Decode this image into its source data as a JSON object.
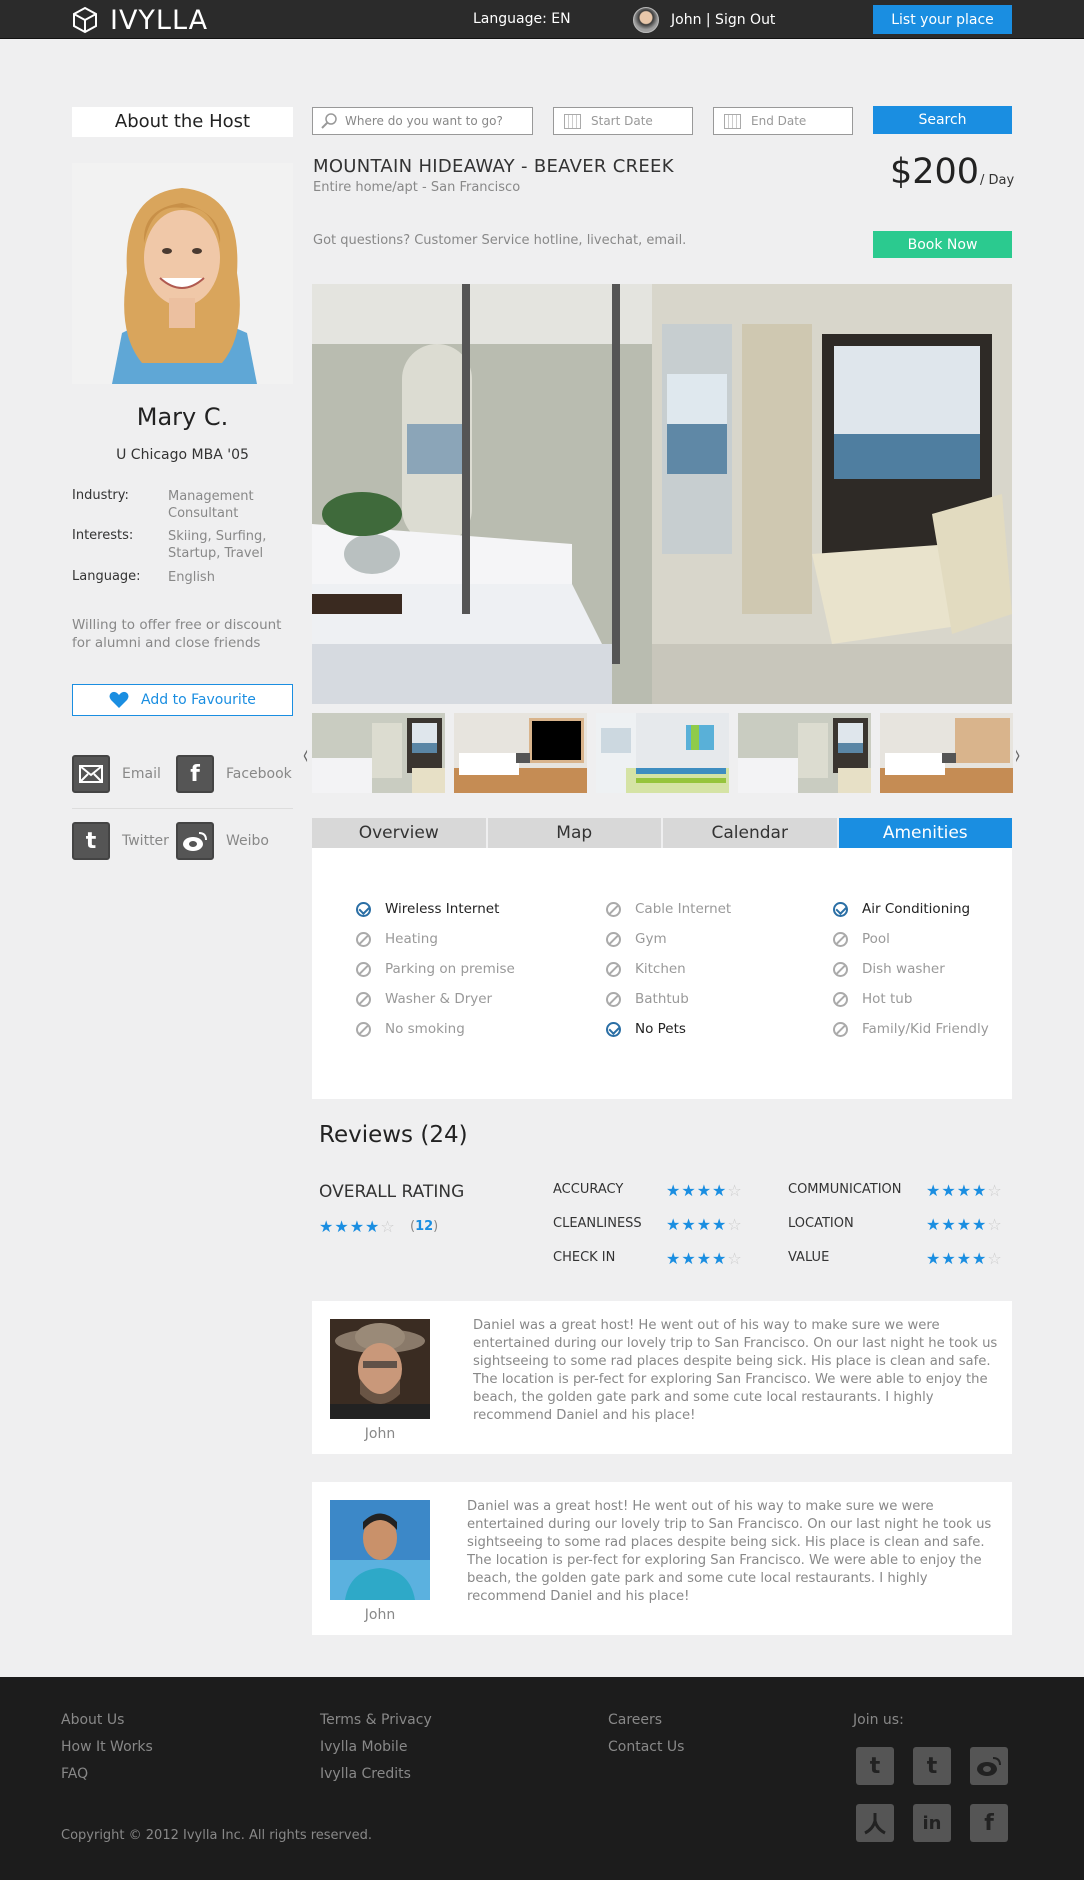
{
  "header": {
    "logo_text": "IVYLLA",
    "language": "Language: EN",
    "user": "John | Sign Out",
    "list_place": "List your place"
  },
  "host": {
    "box_title": "About the Host",
    "name": "Mary C.",
    "school": "U Chicago MBA '05",
    "industry_label": "Industry:",
    "industry_value": "Management Consultant",
    "interests_label": "Interests:",
    "interests_value": "Skiing, Surfing, Startup, Travel",
    "language_label": "Language:",
    "language_value": "English",
    "willing": "Willing to offer free or discount for alumni and close friends",
    "favourite": "Add to Favourite",
    "social": {
      "email": "Email",
      "facebook": "Facebook",
      "twitter": "Twitter",
      "weibo": "Weibo"
    }
  },
  "search": {
    "where_placeholder": "Where do you want to go?",
    "start_placeholder": "Start Date",
    "end_placeholder": "End Date",
    "button": "Search"
  },
  "listing": {
    "title": "MOUNTAIN HIDEAWAY - BEAVER CREEK",
    "subtitle": "Entire home/apt - San Francisco",
    "price": "$200",
    "price_unit": "/ Day",
    "questions": "Got questions? Customer Service hotline, livechat, email.",
    "book": "Book Now"
  },
  "tabs": [
    "Overview",
    "Map",
    "Calendar",
    "Amenities"
  ],
  "amenities": [
    {
      "label": "Wireless Internet",
      "available": true
    },
    {
      "label": "Heating",
      "available": false
    },
    {
      "label": "Parking on premise",
      "available": false
    },
    {
      "label": "Washer & Dryer",
      "available": false
    },
    {
      "label": "No smoking",
      "available": false
    },
    {
      "label": "Cable Internet",
      "available": false
    },
    {
      "label": "Gym",
      "available": false
    },
    {
      "label": "Kitchen",
      "available": false
    },
    {
      "label": "Bathtub",
      "available": false
    },
    {
      "label": "No Pets",
      "available": true
    },
    {
      "label": "Air Conditioning",
      "available": true
    },
    {
      "label": "Pool",
      "available": false
    },
    {
      "label": "Dish washer",
      "available": false
    },
    {
      "label": "Hot tub",
      "available": false
    },
    {
      "label": "Family/Kid Friendly",
      "available": false
    }
  ],
  "reviews": {
    "title": "Reviews (24)",
    "overall_label": "OVERALL RATING",
    "overall_stars": 4,
    "count_open": "(",
    "count": "12",
    "count_close": ")",
    "categories": [
      {
        "label": "ACCURACY",
        "stars": 4
      },
      {
        "label": "CLEANLINESS",
        "stars": 4
      },
      {
        "label": "CHECK IN",
        "stars": 4
      },
      {
        "label": "COMMUNICATION",
        "stars": 4
      },
      {
        "label": "LOCATION",
        "stars": 4
      },
      {
        "label": "VALUE",
        "stars": 4
      }
    ],
    "items": [
      {
        "name": "John",
        "text": "Daniel was a great host! He went out of his way to make sure we were entertained during our lovely trip to San Francisco. On our last night he took us sightseeing to some rad places despite being sick. His place is clean and safe. The location is per-fect for exploring San Francisco. We were able to enjoy the beach, the golden gate park and some cute local restaurants. I highly recommend Daniel and his place!"
      },
      {
        "name": "John",
        "text": "Daniel was a great host! He went out of his way to make sure we were entertained during our lovely trip to San Francisco. On our last night he took us sightseeing to some rad places despite being sick. His place is clean and safe. The location is per-fect for exploring San Francisco. We were able to enjoy the beach, the golden gate park and some cute local restaurants. I highly recommend Daniel and his place!"
      }
    ]
  },
  "footer": {
    "col1": [
      "About Us",
      "How It Works",
      "FAQ"
    ],
    "col2": [
      "Terms & Privacy",
      "Ivylla Mobile",
      "Ivylla Credits"
    ],
    "col3": [
      "Careers",
      "Contact Us"
    ],
    "join": "Join us:",
    "copyright": "Copyright © 2012 Ivylla Inc. All rights reserved."
  }
}
